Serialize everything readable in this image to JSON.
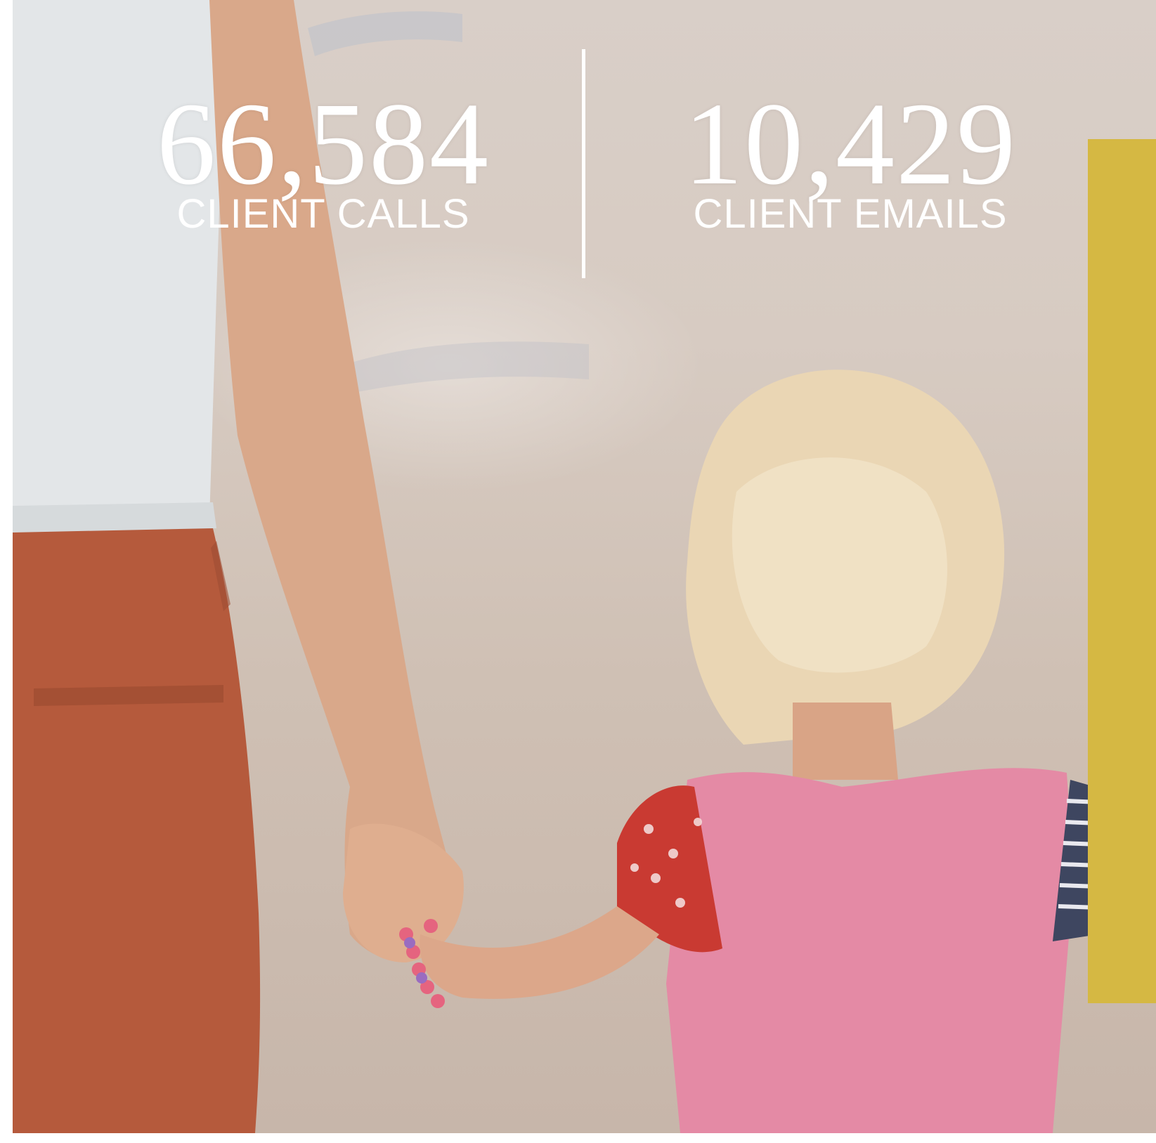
{
  "stats": [
    {
      "value": "66,584",
      "label": "CLIENT CALLS"
    },
    {
      "value": "10,429",
      "label": "CLIENT EMAILS"
    }
  ],
  "colors": {
    "accent_bar": "#d5b843",
    "text": "#ffffff"
  }
}
